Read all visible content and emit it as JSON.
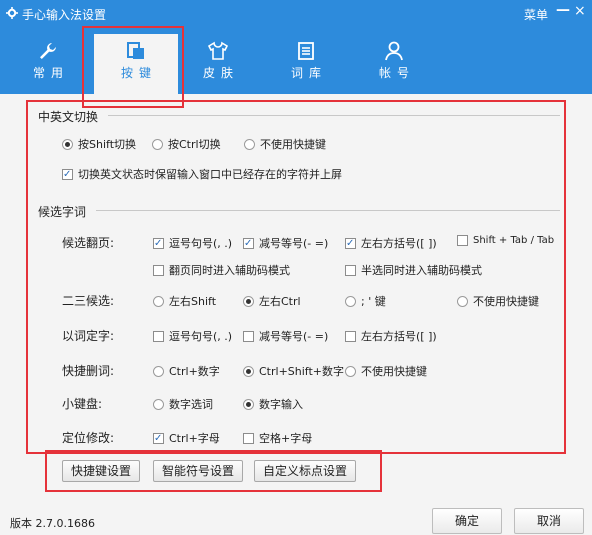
{
  "window": {
    "title": "手心输入法设置",
    "menu_label": "菜单",
    "min_symbol": "—",
    "close_symbol": "×"
  },
  "tabs": [
    {
      "label": "常用",
      "icon": "wrench-icon"
    },
    {
      "label": "按键",
      "icon": "keyboard-icon"
    },
    {
      "label": "皮肤",
      "icon": "shirt-icon"
    },
    {
      "label": "词库",
      "icon": "book-icon"
    },
    {
      "label": "帐号",
      "icon": "user-icon"
    }
  ],
  "active_tab": 1,
  "cn_en_switch": {
    "title": "中英文切换",
    "options": [
      {
        "label": "按Shift切换",
        "selected": true
      },
      {
        "label": "按Ctrl切换",
        "selected": false
      },
      {
        "label": "不使用快捷键",
        "selected": false
      }
    ],
    "keep_checkbox": {
      "label": "切换英文状态时保留输入窗口中已经存在的字符并上屏",
      "checked": true
    }
  },
  "candidates": {
    "title": "候选字词",
    "page_turn": {
      "label": "候选翻页:",
      "options": [
        {
          "label": "逗号句号(, .)",
          "checked": true
        },
        {
          "label": "减号等号(- =)",
          "checked": true
        },
        {
          "label": "左右方括号([ ])",
          "checked": true
        },
        {
          "label": "Shift + Tab / Tab",
          "checked": false
        },
        {
          "label": "翻页同时进入辅助码模式",
          "checked": false
        },
        {
          "label": "半选同时进入辅助码模式",
          "checked": false
        }
      ]
    },
    "second_third": {
      "label": "二三候选:",
      "options": [
        {
          "label": "左右Shift",
          "selected": false
        },
        {
          "label": "左右Ctrl",
          "selected": true
        },
        {
          "label": "; ' 键",
          "selected": false
        },
        {
          "label": "不使用快捷键",
          "selected": false
        }
      ]
    },
    "word_select": {
      "label": "以词定字:",
      "options": [
        {
          "label": "逗号句号(, .)",
          "checked": false
        },
        {
          "label": "减号等号(- =)",
          "checked": false
        },
        {
          "label": "左右方括号([ ])",
          "checked": false
        }
      ]
    },
    "quick_delete": {
      "label": "快捷删词:",
      "options": [
        {
          "label": "Ctrl+数字",
          "selected": false
        },
        {
          "label": "Ctrl+Shift+数字",
          "selected": true
        },
        {
          "label": "不使用快捷键",
          "selected": false
        }
      ]
    },
    "keypad": {
      "label": "小键盘:",
      "options": [
        {
          "label": "数字选词",
          "selected": false
        },
        {
          "label": "数字输入",
          "selected": true
        }
      ]
    },
    "locate_edit": {
      "label": "定位修改:",
      "options": [
        {
          "label": "Ctrl+字母",
          "checked": true
        },
        {
          "label": "空格+字母",
          "checked": false
        }
      ]
    }
  },
  "bottom_buttons": [
    "快捷键设置",
    "智能符号设置",
    "自定义标点设置"
  ],
  "footer": {
    "version": "版本 2.7.0.1686",
    "ok_label": "确定",
    "cancel_label": "取消"
  },
  "colors": {
    "header": "#2d8bdc",
    "highlight_box": "#e5323a"
  }
}
